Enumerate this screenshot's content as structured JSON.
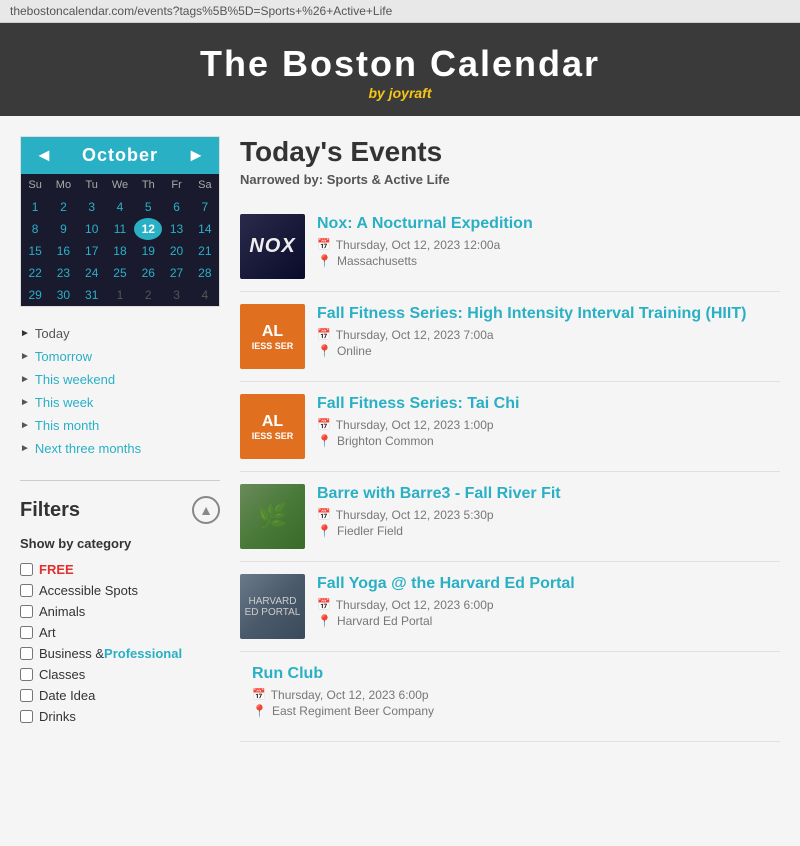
{
  "address_bar": {
    "url": "thebostoncalendar.com/events?tags%5B%5D=Sports+%26+Active+Life"
  },
  "header": {
    "title": "The Boston Calendar",
    "subtitle": "by",
    "brand": "joyraft"
  },
  "calendar": {
    "month": "October",
    "prev_label": "◄",
    "next_label": "►",
    "weekdays": [
      "Su",
      "Mo",
      "Tu",
      "We",
      "Th",
      "Fr",
      "Sa"
    ],
    "weeks": [
      [
        {
          "day": "1",
          "type": "current"
        },
        {
          "day": "2",
          "type": "current"
        },
        {
          "day": "3",
          "type": "current"
        },
        {
          "day": "4",
          "type": "current"
        },
        {
          "day": "5",
          "type": "current"
        },
        {
          "day": "6",
          "type": "current"
        },
        {
          "day": "7",
          "type": "current"
        }
      ],
      [
        {
          "day": "8",
          "type": "current"
        },
        {
          "day": "9",
          "type": "current"
        },
        {
          "day": "10",
          "type": "current"
        },
        {
          "day": "11",
          "type": "current"
        },
        {
          "day": "12",
          "type": "today"
        },
        {
          "day": "13",
          "type": "current"
        },
        {
          "day": "14",
          "type": "current"
        }
      ],
      [
        {
          "day": "15",
          "type": "current"
        },
        {
          "day": "16",
          "type": "current"
        },
        {
          "day": "17",
          "type": "current"
        },
        {
          "day": "18",
          "type": "current"
        },
        {
          "day": "19",
          "type": "current"
        },
        {
          "day": "20",
          "type": "current"
        },
        {
          "day": "21",
          "type": "current"
        }
      ],
      [
        {
          "day": "22",
          "type": "current"
        },
        {
          "day": "23",
          "type": "current"
        },
        {
          "day": "24",
          "type": "current"
        },
        {
          "day": "25",
          "type": "current"
        },
        {
          "day": "26",
          "type": "current"
        },
        {
          "day": "27",
          "type": "current"
        },
        {
          "day": "28",
          "type": "current"
        }
      ],
      [
        {
          "day": "29",
          "type": "current"
        },
        {
          "day": "30",
          "type": "current"
        },
        {
          "day": "31",
          "type": "current"
        },
        {
          "day": "1",
          "type": "other"
        },
        {
          "day": "2",
          "type": "other"
        },
        {
          "day": "3",
          "type": "other"
        },
        {
          "day": "4",
          "type": "other"
        }
      ]
    ]
  },
  "quick_nav": {
    "items": [
      {
        "label": "Today",
        "type": "active",
        "href": "#"
      },
      {
        "label": "Tomorrow",
        "type": "link",
        "href": "#"
      },
      {
        "label": "This weekend",
        "type": "link",
        "href": "#"
      },
      {
        "label": "This week",
        "type": "link",
        "href": "#"
      },
      {
        "label": "This month",
        "type": "link",
        "href": "#"
      },
      {
        "label": "Next three months",
        "type": "link",
        "href": "#"
      }
    ]
  },
  "filters": {
    "title": "Filters",
    "toggle_label": "▲",
    "category_label": "Show by category",
    "items": [
      {
        "label": "FREE",
        "special": "free"
      },
      {
        "label": "Accessible Spots",
        "special": "none"
      },
      {
        "label": "Animals",
        "special": "none"
      },
      {
        "label": "Art",
        "special": "none"
      },
      {
        "label": "Business &",
        "highlight": "Professional",
        "special": "highlight"
      },
      {
        "label": "Classes",
        "special": "none"
      },
      {
        "label": "Date Idea",
        "special": "none"
      },
      {
        "label": "Drinks",
        "special": "none"
      }
    ]
  },
  "content": {
    "title": "Today's Events",
    "narrowed_by_label": "Narrowed by:",
    "narrowed_by_value": "Sports & Active Life",
    "events": [
      {
        "id": "nox",
        "title": "Nox: A Nocturnal Expedition",
        "datetime": "Thursday, Oct 12, 2023 12:00a",
        "location": "Massachusetts",
        "thumb_type": "nox",
        "thumb_text": "NOX"
      },
      {
        "id": "hiit",
        "title": "Fall Fitness Series: High Intensity Interval Training (HIIT)",
        "datetime": "Thursday, Oct 12, 2023 7:00a",
        "location": "Online",
        "thumb_type": "al",
        "thumb_text": "AL",
        "thumb_sub": "IESS SER"
      },
      {
        "id": "taichi",
        "title": "Fall Fitness Series: Tai Chi",
        "datetime": "Thursday, Oct 12, 2023 1:00p",
        "location": "Brighton Common",
        "thumb_type": "al",
        "thumb_text": "AL",
        "thumb_sub": "IESS SER"
      },
      {
        "id": "barre",
        "title": "Barre with Barre3 - Fall River Fit",
        "datetime": "Thursday, Oct 12, 2023 5:30p",
        "location": "Fiedler Field",
        "thumb_type": "barre"
      },
      {
        "id": "yoga",
        "title": "Fall Yoga @ the Harvard Ed Portal",
        "datetime": "Thursday, Oct 12, 2023 6:00p",
        "location": "Harvard Ed Portal",
        "thumb_type": "yoga"
      },
      {
        "id": "runclub",
        "title": "Run Club",
        "datetime": "Thursday, Oct 12, 2023 6:00p",
        "location": "East Regiment Beer Company",
        "thumb_type": "none"
      }
    ]
  },
  "icons": {
    "calendar_icon": "📅",
    "location_icon": "📍",
    "prev_icon": "◄",
    "next_icon": "►"
  }
}
